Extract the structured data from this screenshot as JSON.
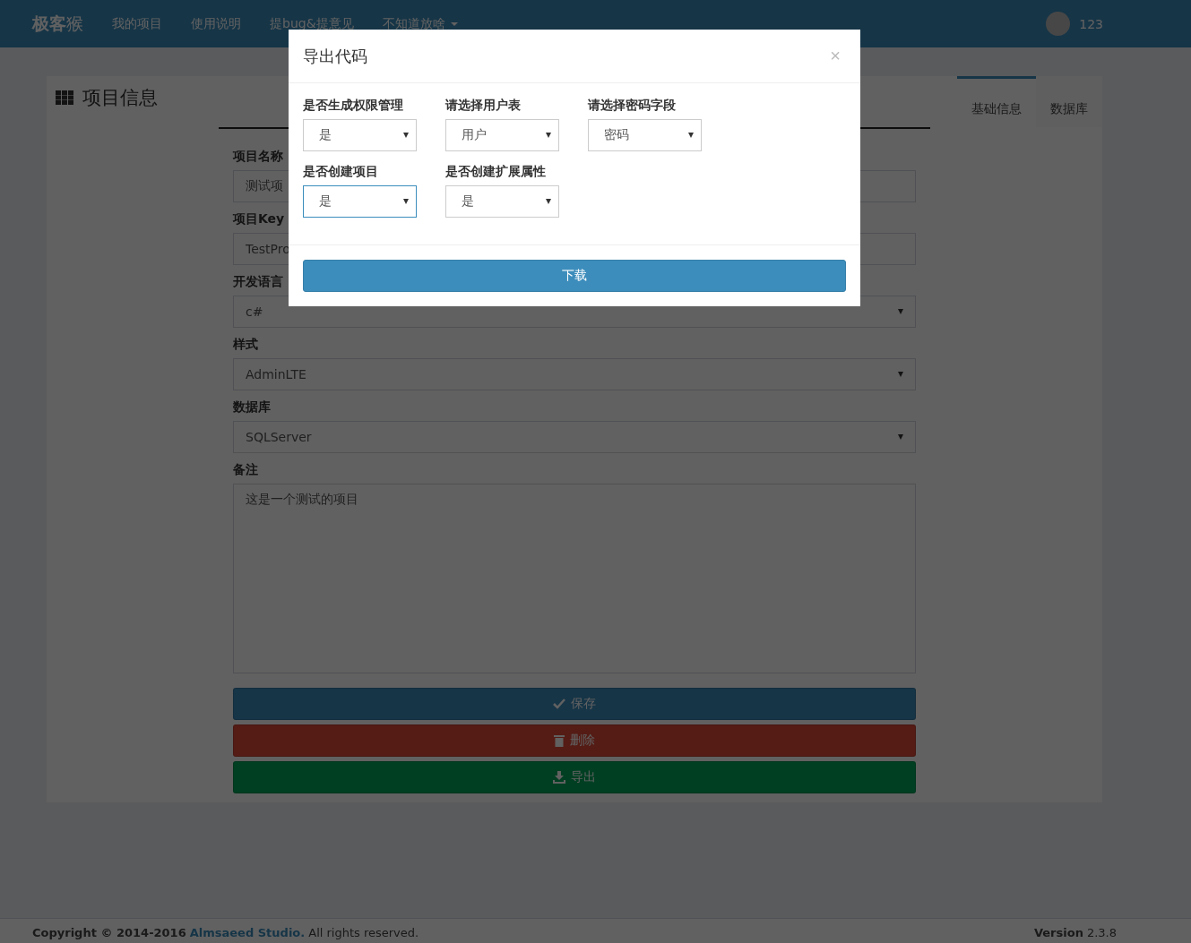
{
  "navbar": {
    "logo_bold": "极客",
    "logo_light": "猴",
    "items": [
      {
        "label": "我的项目",
        "dropdown": false
      },
      {
        "label": "使用说明",
        "dropdown": false
      },
      {
        "label": "提bug&提意见",
        "dropdown": false
      },
      {
        "label": "不知道放啥",
        "dropdown": true
      }
    ],
    "user": "123"
  },
  "panel": {
    "title": "项目信息",
    "tabs": [
      {
        "label": "基础信息",
        "selected": true
      },
      {
        "label": "数据库",
        "selected": false
      }
    ],
    "fields": [
      {
        "label": "项目名称",
        "kind": "input",
        "value": "测试项"
      },
      {
        "label": "项目Key",
        "kind": "input",
        "value": "TestPro"
      },
      {
        "label": "开发语言",
        "kind": "select",
        "value": "c#"
      },
      {
        "label": "样式",
        "kind": "select",
        "value": "AdminLTE"
      },
      {
        "label": "数据库",
        "kind": "select",
        "value": "SQLServer"
      },
      {
        "label": "备注",
        "kind": "textarea",
        "value": "这是一个测试的项目"
      }
    ],
    "buttons": [
      {
        "label": "保存",
        "kind": "save"
      },
      {
        "label": "删除",
        "kind": "delete"
      },
      {
        "label": "导出",
        "kind": "export"
      }
    ]
  },
  "footer": {
    "copyright": "Copyright © 2014-2016",
    "link": "Almsaeed Studio.",
    "rights": "All rights reserved.",
    "version_label": "Version",
    "version": "2.3.8"
  },
  "modal": {
    "title": "导出代码",
    "close": "×",
    "fields": [
      {
        "label": "是否生成权限管理",
        "value": "是",
        "focused": false
      },
      {
        "label": "请选择用户表",
        "value": "用户",
        "focused": false
      },
      {
        "label": "请选择密码字段",
        "value": "密码",
        "focused": false
      },
      {
        "label": "是否创建项目",
        "value": "是",
        "focused": true
      },
      {
        "label": "是否创建扩展属性",
        "value": "是",
        "focused": false
      }
    ],
    "button": "下载"
  }
}
